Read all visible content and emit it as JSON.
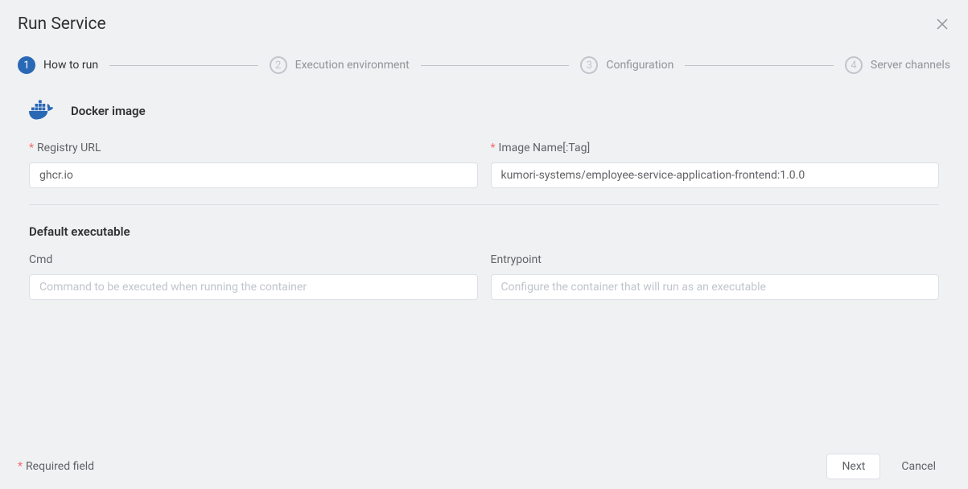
{
  "dialog": {
    "title": "Run Service"
  },
  "steps": [
    {
      "number": "1",
      "label": "How to run",
      "active": true
    },
    {
      "number": "2",
      "label": "Execution environment",
      "active": false
    },
    {
      "number": "3",
      "label": "Configuration",
      "active": false
    },
    {
      "number": "4",
      "label": "Server channels",
      "active": false
    }
  ],
  "docker": {
    "section_title": "Docker image",
    "registry_label": "Registry URL",
    "registry_value": "ghcr.io",
    "image_label": "Image Name[:Tag]",
    "image_value": "kumori-systems/employee-service-application-frontend:1.0.0"
  },
  "executable": {
    "section_title": "Default executable",
    "cmd_label": "Cmd",
    "cmd_placeholder": "Command to be executed when running the container",
    "entrypoint_label": "Entrypoint",
    "entrypoint_placeholder": "Configure the container that will run as an executable"
  },
  "footer": {
    "required_note": "Required field",
    "next": "Next",
    "cancel": "Cancel"
  }
}
